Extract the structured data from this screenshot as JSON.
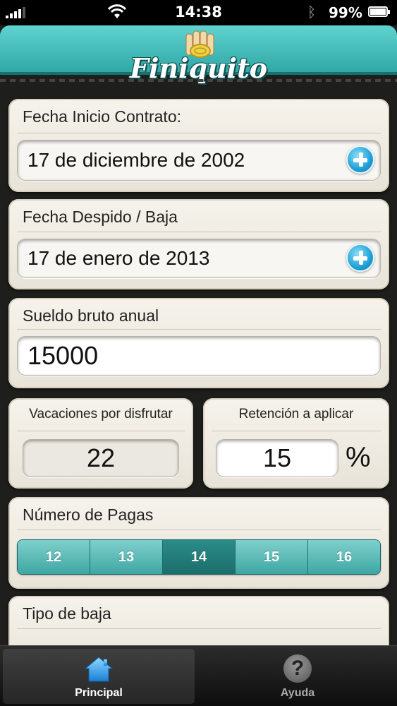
{
  "status_bar": {
    "time": "14:38",
    "battery_percent": "99%"
  },
  "header": {
    "app_title": "Finiquito"
  },
  "start_date": {
    "label": "Fecha Inicio Contrato:",
    "value": "17 de diciembre de 2002"
  },
  "end_date": {
    "label": "Fecha Despido / Baja",
    "value": "17 de enero de 2013"
  },
  "salary": {
    "label": "Sueldo bruto anual",
    "value": "15000"
  },
  "vacation": {
    "label": "Vacaciones por disfrutar",
    "value": "22"
  },
  "retention": {
    "label": "Retención a aplicar",
    "value": "15",
    "unit": "%"
  },
  "payments": {
    "label": "Número de Pagas",
    "options": [
      "12",
      "13",
      "14",
      "15",
      "16"
    ],
    "selected": "14"
  },
  "leave_type": {
    "label": "Tipo de baja"
  },
  "tab_bar": {
    "tabs": [
      {
        "label": "Principal",
        "icon": "home-icon",
        "active": true
      },
      {
        "label": "Ayuda",
        "icon": "help-icon",
        "active": false
      }
    ]
  },
  "colors": {
    "accent_teal": "#3ea7a3",
    "plus_blue": "#1f9fd8",
    "card_background": "#f6f3ec"
  }
}
